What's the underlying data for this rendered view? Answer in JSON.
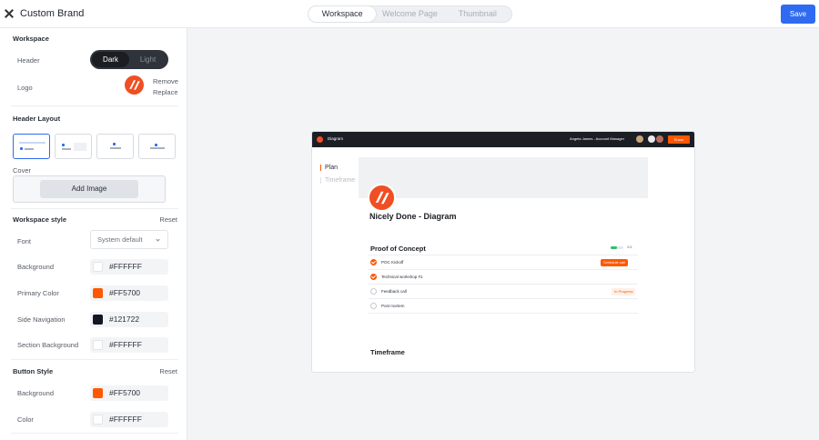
{
  "header": {
    "title": "Custom Brand",
    "tabs": [
      "Workspace",
      "Welcome Page",
      "Thumbnail"
    ],
    "active_tab": "Workspace",
    "save_label": "Save",
    "accent": "#2F6BF0"
  },
  "panel": {
    "workspace": {
      "title": "Workspace",
      "header_label": "Header",
      "theme_options": [
        "Dark",
        "Light"
      ],
      "theme_selected": "Dark",
      "logo_label": "Logo",
      "logo_actions": [
        "Remove",
        "Replace"
      ]
    },
    "header_layout": {
      "title": "Header Layout",
      "selected_index": 0,
      "cover_label": "Cover",
      "add_image_label": "Add Image"
    },
    "workspace_style": {
      "title": "Workspace style",
      "reset_label": "Reset",
      "font_label": "Font",
      "font_value": "System default",
      "colors": [
        {
          "label": "Background",
          "hex": "#FFFFFF"
        },
        {
          "label": "Primary Color",
          "hex": "#FF5700"
        },
        {
          "label": "Side Navigation",
          "hex": "#121722"
        },
        {
          "label": "Section Background",
          "hex": "#FFFFFF"
        }
      ]
    },
    "button_style": {
      "title": "Button Style",
      "reset_label": "Reset",
      "colors": [
        {
          "label": "Background",
          "hex": "#FF5700"
        },
        {
          "label": "Color",
          "hex": "#FFFFFF"
        }
      ]
    }
  },
  "preview": {
    "brand": "Diagram",
    "user": "Angela James - Account Manager",
    "share_label": "Share",
    "nav": [
      "Plan",
      "Timeframe"
    ],
    "workspace_title": "Nicely Done - Diagram",
    "section_title": "Proof of Concept",
    "progress_text": "2/4",
    "progress_fraction": 0.5,
    "tasks": [
      {
        "label": "POC Kickoff",
        "done": true
      },
      {
        "label": "Technical workshop #1",
        "done": true
      },
      {
        "label": "Feedback call",
        "done": false
      },
      {
        "label": "Post mortem",
        "done": false
      }
    ],
    "schedule_call_label": "Schedule call",
    "status_label": "In Progress",
    "timeframe_title": "Timeframe"
  }
}
